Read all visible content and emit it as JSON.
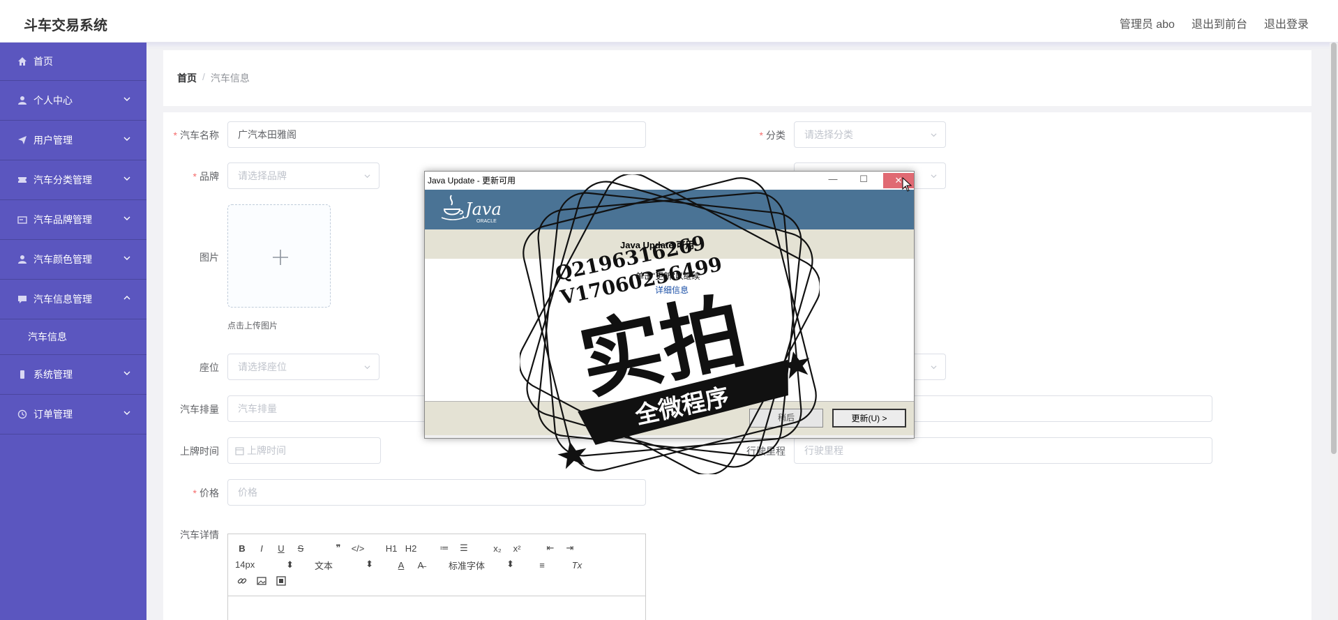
{
  "app": {
    "title": "斗车交易系统"
  },
  "header": {
    "admin": "管理员 abo",
    "exit_front": "退出到前台",
    "logout": "退出登录"
  },
  "sidebar": {
    "items": [
      {
        "label": "首页",
        "icon": "home-icon"
      },
      {
        "label": "个人中心",
        "icon": "user-icon"
      },
      {
        "label": "用户管理",
        "icon": "send-icon"
      },
      {
        "label": "汽车分类管理",
        "icon": "ticket-icon"
      },
      {
        "label": "汽车品牌管理",
        "icon": "card-icon"
      },
      {
        "label": "汽车颜色管理",
        "icon": "user-icon"
      },
      {
        "label": "汽车信息管理",
        "icon": "chat-icon"
      },
      {
        "label": "系统管理",
        "icon": "phone-icon"
      },
      {
        "label": "订单管理",
        "icon": "clock-icon"
      }
    ],
    "sub_item": "汽车信息"
  },
  "breadcrumb": {
    "home": "首页",
    "sep": "/",
    "current": "汽车信息"
  },
  "form": {
    "car_name_label": "汽车名称",
    "car_name_value": "广汽本田雅阁",
    "category_label": "分类",
    "category_placeholder": "请选择分类",
    "brand_label": "品牌",
    "brand_placeholder": "请选择品牌",
    "image_label": "图片",
    "upload_tip": "点击上传图片",
    "seat_label": "座位",
    "seat_placeholder": "请选择座位",
    "displacement_label": "汽车排量",
    "displacement_placeholder": "汽车排量",
    "plate_time_label": "上牌时间",
    "plate_time_placeholder": "上牌时间",
    "mileage_label": "行驶里程",
    "mileage_placeholder": "行驶里程",
    "price_label": "价格",
    "price_placeholder": "价格",
    "details_label": "汽车详情"
  },
  "editor": {
    "row1": [
      "B",
      "I",
      "U",
      "S",
      "❞",
      "</>",
      "H1",
      "H2",
      "≔",
      "☰",
      "x₂",
      "x²",
      "⇤",
      "⇥"
    ],
    "font_size": "14px",
    "block_type": "文本",
    "font_family": "标准字体",
    "row2_tools": [
      "A",
      "A̶",
      "≡",
      "Tx"
    ],
    "row3": [
      "🔗",
      "▣",
      "▤"
    ]
  },
  "java_dialog": {
    "title": "Java Update - 更新可用",
    "logo_text": "Java",
    "logo_sub": "ORACLE",
    "heading": "Java Update 可用",
    "message": "单击\"更新\"以继续",
    "link": "详细信息",
    "cancel": "稍后",
    "update": "更新(U) >",
    "min_btn": "—",
    "max_btn": "☐",
    "close_btn": "✕"
  },
  "stamp": {
    "line1": "Q2196316269",
    "line2": "V17060256499",
    "big": "实拍",
    "ribbon": "全微程序"
  }
}
